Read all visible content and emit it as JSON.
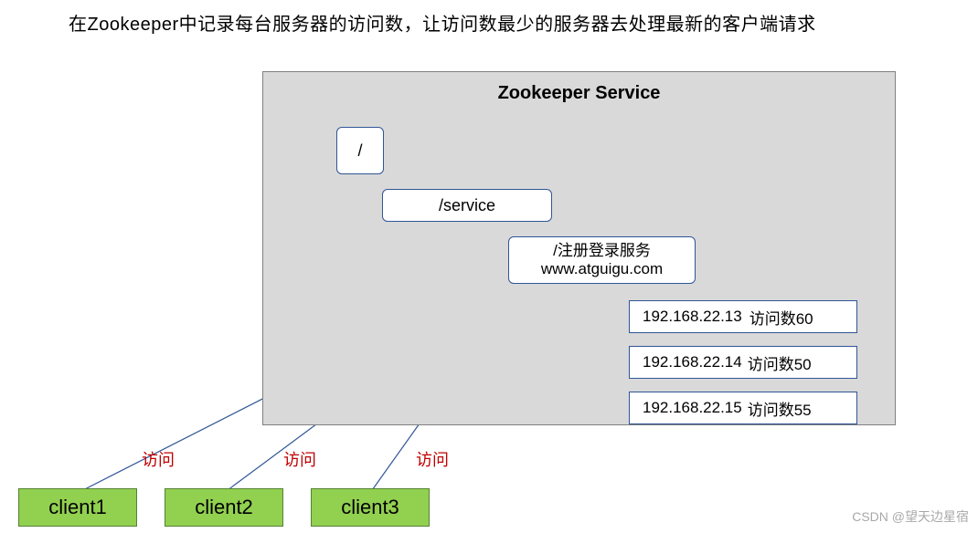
{
  "caption": "在Zookeeper中记录每台服务器的访问数，让访问数最少的服务器去处理最新的客户端请求",
  "panel_title": "Zookeeper Service",
  "nodes": {
    "root": "/",
    "service": "/service",
    "register_line1": "/注册登录服务",
    "register_line2": "www.atguigu.com"
  },
  "servers": [
    {
      "ip": "192.168.22.13",
      "visits_label": "访问数60"
    },
    {
      "ip": "192.168.22.14",
      "visits_label": "访问数50"
    },
    {
      "ip": "192.168.22.15",
      "visits_label": "访问数55"
    }
  ],
  "clients": [
    {
      "name": "client1",
      "label": "访问"
    },
    {
      "name": "client2",
      "label": "访问"
    },
    {
      "name": "client3",
      "label": "访问"
    }
  ],
  "watermark": "CSDN @望天边星宿"
}
